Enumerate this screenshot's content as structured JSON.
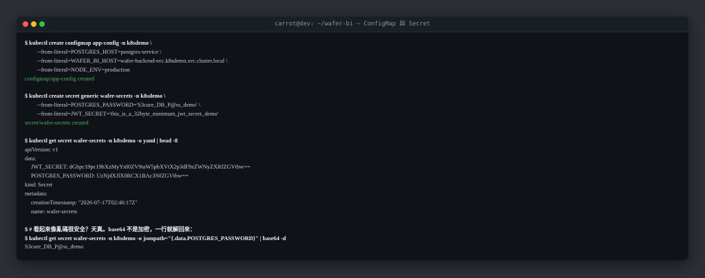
{
  "window": {
    "title": "carrot@dev: ~/wafer-bi — ConfigMap 與 Secret"
  },
  "lines": {
    "l01": "$ kubectl create configmap app-config -n k8sdemo \\",
    "l02": "--from-literal=POSTGRES_HOST=postgres-service \\",
    "l03": "--from-literal=WAFER_BI_HOST=wafer-backend-svc.k8sdemo.svc.cluster.local \\",
    "l04": "--from-literal=NODE_ENV=production",
    "l05": "configmap/app-config created",
    "l06": "$ kubectl create secret generic wafer-secrets -n k8sdemo \\",
    "l07": "--from-literal=POSTGRES_PASSWORD='S3cure_DB_P@ss_demo' \\",
    "l08": "--from-literal=JWT_SECRET='this_is_a_32byte_minimum_jwt_secret_demo'",
    "l09": "secret/wafer-secrets created",
    "l10": "$ kubectl get secret wafer-secrets -n k8sdemo -o yaml | head -8",
    "l11": "apiVersion: v1",
    "l12": "data:",
    "l13": "JWT_SECRET: dGhpc19pc19hXzMyYnl0ZV9taW5pbXVtX2p3dF9zZWNyZXRfZGVtbw==",
    "l14": "POSTGRES_PASSWORD: UzNjdXJlX0RCX1BAc3NfZGVtbw==",
    "l15": "kind: Secret",
    "l16": "metadata:",
    "l17": "creationTimestamp: \"2026-07-17T02:46:17Z\"",
    "l18": "name: wafer-secrets",
    "l19": "$ # 看起來像亂碼很安全？天真。base64 不是加密，一行就解回來：",
    "l20": "$ kubectl get secret wafer-secrets -n k8sdemo -o jsonpath=\"{.data.POSTGRES_PASSWORD}\" | base64 -d",
    "l21": "S3cure_DB_P@ss_demo"
  },
  "colors": {
    "background": "#2b2e34",
    "terminal_bg": "#0f1318",
    "titlebar_bg": "#1a1e25",
    "success": "#49b35a",
    "command": "#eef0f3",
    "output": "#c8ccd2"
  }
}
